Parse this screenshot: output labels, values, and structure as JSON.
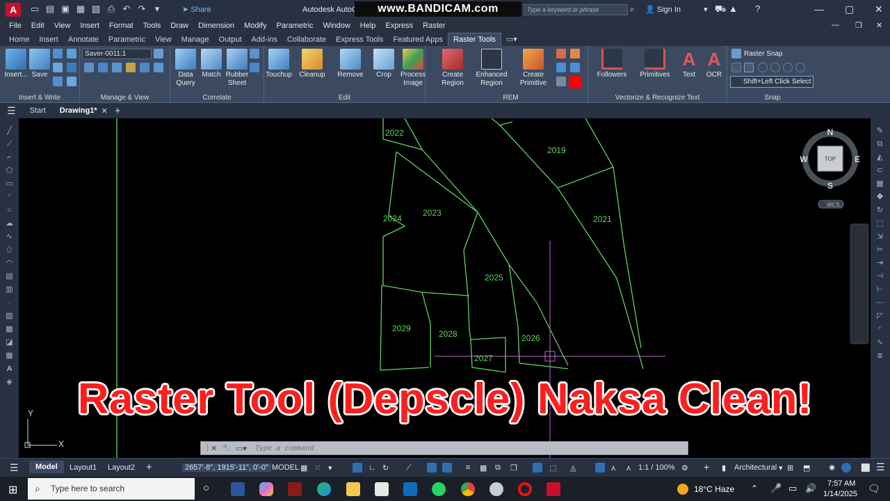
{
  "titlebar": {
    "app_logo": "A",
    "share": "Share",
    "title": "Autodesk AutoC",
    "bandicam": "www.BANDICAM.com",
    "search_placeholder": "Type a keyword or phrase",
    "sign_in": "Sign In"
  },
  "menu": [
    "File",
    "Edit",
    "View",
    "Insert",
    "Format",
    "Tools",
    "Draw",
    "Dimension",
    "Modify",
    "Parametric",
    "Window",
    "Help",
    "Express",
    "Raster"
  ],
  "ribbon_tabs": [
    "Home",
    "Insert",
    "Annotate",
    "Parametric",
    "View",
    "Manage",
    "Output",
    "Add-ins",
    "Collaborate",
    "Express Tools",
    "Featured Apps",
    "Raster Tools"
  ],
  "active_ribbon_tab": "Raster Tools",
  "ribbon": {
    "insert_label": "Insert...",
    "save_label": "Save",
    "saver_value": "Saver-0011:1",
    "data_query": "Data\nQuery",
    "match": "Match",
    "rubber_sheet": "Rubber\nSheet",
    "touchup": "Touchup",
    "cleanup": "Cleanup",
    "remove": "Remove",
    "crop": "Crop",
    "process_image": "Process\nImage",
    "create_region": "Create\nRegion",
    "enhanced_region": "Enhanced\nRegion",
    "create_primitive": "Create\nPrimitive",
    "followers": "Followers",
    "primitives": "Primitives",
    "text": "Text",
    "ocr": "OCR",
    "raster_snap": "Raster Snap",
    "shift_select": "Shift+Left Click Select",
    "panels": {
      "insert_write": "Insert & Write",
      "manage_view": "Manage & View",
      "correlate": "Correlate",
      "edit": "Edit",
      "rem": "REM",
      "vectorize": "Vectorize & Recognize Text",
      "snap": "Snap"
    }
  },
  "file_tabs": {
    "start": "Start",
    "drawing": "Drawing1*"
  },
  "drawing": {
    "parcels": [
      "2022",
      "2019",
      "2023",
      "2024",
      "2021",
      "2025",
      "2029",
      "2028",
      "2026",
      "2027"
    ]
  },
  "viewcube": {
    "n": "N",
    "s": "S",
    "e": "E",
    "w": "W",
    "top": "TOP",
    "wcs": "WCS"
  },
  "command": {
    "placeholder": "Type a command"
  },
  "status": {
    "model": "Model",
    "layout1": "Layout1",
    "layout2": "Layout2",
    "coords": "2657'-8\", 1915'-11\", 0'-0\"",
    "model_space": "MODEL",
    "scale": "1:1 / 100%",
    "units": "Architectural"
  },
  "taskbar": {
    "search_placeholder": "Type here to search",
    "weather": "18°C  Haze",
    "time": "7:57 AM",
    "date": "1/14/2025"
  },
  "overlay": "Raster Tool (Depscle) Naksa Clean!",
  "colors": {
    "parcel_lines": "#5fd35f",
    "crosshair": "#c06ad0",
    "overlay": "#ff1e1e"
  }
}
